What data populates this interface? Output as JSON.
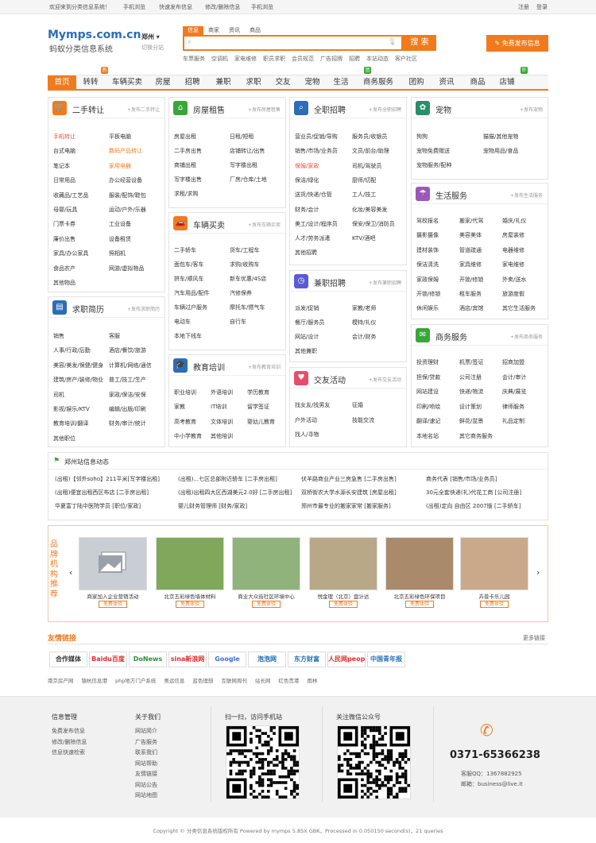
{
  "topbar": {
    "welcome": "欢迎来到分类信息系统！",
    "links": [
      "手机浏览",
      "快速发布信息",
      "修改/删除信息",
      "手机浏览"
    ],
    "login": "登录",
    "register": "注册"
  },
  "header": {
    "logo": "Mymps.com.cn",
    "slogan": "蚂蚁分类信息系统",
    "city": "郑州",
    "city_switch": "切换分站",
    "search_tabs": [
      "信息",
      "商家",
      "资讯",
      "商品"
    ],
    "search_button": "搜 索",
    "hot_words": [
      "车票服务",
      "空调机",
      "家电维修",
      "职员求职",
      "会员规范",
      "广告招牌",
      "招聘",
      "本站动态",
      "客户社区"
    ],
    "post_button": "免费发布信息"
  },
  "nav": {
    "items": [
      "首页",
      "转转",
      "车辆买卖",
      "房屋",
      "招聘",
      "兼职",
      "求职",
      "交友",
      "宠物",
      "生活",
      "商务服务",
      "团购",
      "资讯",
      "商品",
      "店铺"
    ],
    "badges": [
      {
        "label": "热",
        "color": "#f07b1f"
      },
      {
        "label": "团",
        "color": "#3aa53a"
      },
      {
        "label": "折",
        "color": "#3aa53a"
      }
    ]
  },
  "panels": {
    "ershou": {
      "title": "二手转让",
      "post": "+发布二手转让",
      "items": [
        "手机转让",
        "平板电脑",
        "台式电脑",
        "数码产品转让",
        "笔记本",
        "家用电器",
        "日常用品",
        "办公经营设备",
        "收藏品/工艺品",
        "服装/配饰/鞋包",
        "母婴/玩具",
        "运动/户外/乐器",
        "门票卡券",
        "工业设备",
        "廉价出售",
        "设备租赁",
        "家具/办公家具",
        "照相机",
        "食品农产",
        "网游/虚拟物品",
        "其他物品"
      ]
    },
    "fangwu": {
      "title": "房屋租售",
      "post": "+发布房屋租售",
      "items": [
        "房屋出租",
        "日租/短租",
        "二手房出售",
        "店铺转让/出售",
        "商铺出租",
        "写字楼出租",
        "写字楼出售",
        "厂房/仓库/土地",
        "求租/求购"
      ]
    },
    "zhaopin": {
      "title": "全职招聘",
      "post": "+发布全职招聘",
      "items": [
        "营业员/促销/导购",
        "服务员/收银员",
        "销售/市场/业务员",
        "文员/前台/助理",
        "保姆/家政",
        "司机/驾驶员",
        "保洁/绿化",
        "厨师/切配",
        "送货/快递/仓管",
        "工人/技工",
        "财务/会计",
        "化妆/美容美发",
        "美工/设计/程序员",
        "保安/保卫/消防员",
        "人才/劳务派遣",
        "KTV/酒吧",
        "其他招聘"
      ]
    },
    "chongwu": {
      "title": "宠物",
      "post": "+发布宠物",
      "items": [
        "狗狗",
        "猫猫/其他宠物",
        "宠物免费赠送",
        "宠物用品/食品",
        "宠物服务/配种"
      ]
    },
    "cheliang": {
      "title": "车辆买卖",
      "post": "+发布车辆买卖",
      "items": [
        "二手轿车",
        "货车/工程车",
        "面包车/客车",
        "求购/收购车",
        "拼车/顺风车",
        "新车优惠/4S店",
        "汽车用品/配件",
        "汽修保养",
        "车辆过户服务",
        "摩托车/燃气车",
        "电动车",
        "自行车",
        "本地下线车"
      ]
    },
    "shenghuo": {
      "title": "生活服务",
      "post": "+发布生活服务",
      "items": [
        "驾校报名",
        "搬家/代驾",
        "婚庆/礼仪",
        "摄影摄像",
        "美容美体",
        "房屋装修",
        "建材装饰",
        "管道疏通",
        "电器维修",
        "保洁清洗",
        "家具维修",
        "家电维修",
        "家政保姆",
        "开锁/修锁",
        "外卖/送水",
        "开锁/修锁",
        "租车服务",
        "旅游度假",
        "休闲娱乐",
        "酒店/宾馆",
        "其它生活服务"
      ]
    },
    "qiuzhi": {
      "title": "求职简历",
      "post": "+发布求职简历",
      "items": [
        "销售",
        "客服",
        "人事/行政/后勤",
        "酒店/餐饮/旅游",
        "美容/美发/保健/健身",
        "计算机/网络/通信",
        "建筑/房产/装修/物业",
        "普工/技工/生产",
        "司机",
        "家政/保洁/安保",
        "影视/娱乐/KTV",
        "编辑/出版/印刷",
        "教育培训/翻译",
        "财务/审计/统计",
        "其他职位"
      ]
    },
    "jianzhi": {
      "title": "兼职招聘",
      "post": "+发布兼职招聘",
      "items": [
        "派发/促销",
        "家教/老师",
        "餐厅/服务员",
        "模特/礼仪",
        "网站/设计",
        "会计/财务",
        "其他兼职"
      ]
    },
    "shangwu": {
      "title": "商务服务",
      "post": "+发布商务服务",
      "items": [
        "投资理财",
        "机票/签证",
        "招商加盟",
        "担保/贷款",
        "公司注册",
        "会计/审计",
        "网站建设",
        "快递/物流",
        "庆典/展览",
        "印刷/喷绘",
        "设计策划",
        "律师服务",
        "翻译/速记",
        "鲜花/盆景",
        "礼品定制",
        "本地名站",
        "其它商务服务"
      ]
    },
    "jiaoyu": {
      "title": "教育培训",
      "post": "+发布教育培训",
      "items": [
        "职业培训",
        "外语培训",
        "学历教育",
        "家教",
        "IT培训",
        "留学签证",
        "高考教育",
        "文体培训",
        "婴幼儿教育",
        "中小学教育",
        "其他培训"
      ]
    },
    "jiaoyou": {
      "title": "交友活动",
      "post": "+发布交友活动",
      "items": [
        "找女友/找男友",
        "征婚",
        "户外活动",
        "技能交流",
        "找人/寻物"
      ]
    }
  },
  "news": {
    "title": "郑州站信息动态",
    "items": [
      "(出租)【邻外soho】211平米[写字楼出租]",
      "(出租)...七区总部附近轿车 [二手房出租]",
      "伏羊路商业产业三房急售 [二手房出售]",
      "商务代表 [销售/市场/业务员]",
      "(出租)便宜出租西区布店 [二手房出租]",
      "(出租)出租四大区西湖美元2.0好 [二手房出租]",
      "双桥街农大学水源长安建筑 [房屋出租]",
      "30元全套快递(礼)代花工商 [公司注册]",
      "华夏富丁陆中医院学员 [职位/家政]",
      "婴儿财务管理师 [财务/家政]",
      "郑州市最专业的搬家家常 [搬家服务]",
      "(出租)定向 自由区 2007版 [二手轿车]"
    ]
  },
  "brand": {
    "side_title": "品牌机构推荐",
    "button_label": "免费体验",
    "cards": [
      "商家加入企业营销活动",
      "北京五彩绿色墙体材料",
      "商业大众街社区环境中心",
      "悦金理（北京）盘计达",
      "北京五彩绿色环保项目",
      "卉普卡乐儿园"
    ]
  },
  "links": {
    "title": "友情链接",
    "more": "更多链接",
    "logos": [
      "合作媒体",
      "Baidu百度",
      "DoNews",
      "sina新浪网",
      "Google",
      "泡泡网",
      "东方财富",
      "人民网people",
      "中国青年报"
    ],
    "text_links": [
      "南京房产网",
      "镇杭信息港",
      "php地方门户系统",
      "奥运信息",
      "蓝色理想",
      "互联网周刊",
      "站长网",
      "红色贵港",
      "雨林"
    ]
  },
  "footer": {
    "col1_title": "信息管理",
    "col1": [
      "免费发布信息",
      "修改/删除信息",
      "信息快速检索"
    ],
    "col2_title": "关于我们",
    "col2": [
      "网站简介",
      "广告服务",
      "联系我们",
      "网站帮助",
      "友情链接",
      "网站公告",
      "网站地图"
    ],
    "qr1_title": "扫一扫，访问手机站",
    "qr2_title": "关注微信公众号",
    "phone": "0371-65366238",
    "qq": "客服QQ：1367882925",
    "email": "邮箱：business@live.it",
    "copyright": "Copyright © 分类信息系统版权所有  Powered by mymps 5.8SX GBK，Processed in 0.050150 second(s)，21 queries"
  }
}
